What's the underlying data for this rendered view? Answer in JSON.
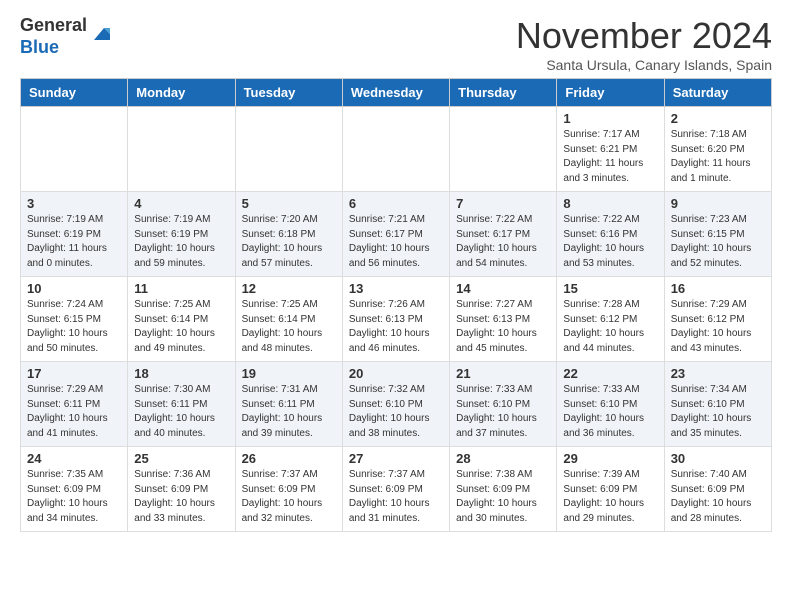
{
  "header": {
    "logo_general": "General",
    "logo_blue": "Blue",
    "month_title": "November 2024",
    "location": "Santa Ursula, Canary Islands, Spain"
  },
  "days_of_week": [
    "Sunday",
    "Monday",
    "Tuesday",
    "Wednesday",
    "Thursday",
    "Friday",
    "Saturday"
  ],
  "weeks": [
    [
      {
        "day": "",
        "info": ""
      },
      {
        "day": "",
        "info": ""
      },
      {
        "day": "",
        "info": ""
      },
      {
        "day": "",
        "info": ""
      },
      {
        "day": "",
        "info": ""
      },
      {
        "day": "1",
        "info": "Sunrise: 7:17 AM\nSunset: 6:21 PM\nDaylight: 11 hours and 3 minutes."
      },
      {
        "day": "2",
        "info": "Sunrise: 7:18 AM\nSunset: 6:20 PM\nDaylight: 11 hours and 1 minute."
      }
    ],
    [
      {
        "day": "3",
        "info": "Sunrise: 7:19 AM\nSunset: 6:19 PM\nDaylight: 11 hours and 0 minutes."
      },
      {
        "day": "4",
        "info": "Sunrise: 7:19 AM\nSunset: 6:19 PM\nDaylight: 10 hours and 59 minutes."
      },
      {
        "day": "5",
        "info": "Sunrise: 7:20 AM\nSunset: 6:18 PM\nDaylight: 10 hours and 57 minutes."
      },
      {
        "day": "6",
        "info": "Sunrise: 7:21 AM\nSunset: 6:17 PM\nDaylight: 10 hours and 56 minutes."
      },
      {
        "day": "7",
        "info": "Sunrise: 7:22 AM\nSunset: 6:17 PM\nDaylight: 10 hours and 54 minutes."
      },
      {
        "day": "8",
        "info": "Sunrise: 7:22 AM\nSunset: 6:16 PM\nDaylight: 10 hours and 53 minutes."
      },
      {
        "day": "9",
        "info": "Sunrise: 7:23 AM\nSunset: 6:15 PM\nDaylight: 10 hours and 52 minutes."
      }
    ],
    [
      {
        "day": "10",
        "info": "Sunrise: 7:24 AM\nSunset: 6:15 PM\nDaylight: 10 hours and 50 minutes."
      },
      {
        "day": "11",
        "info": "Sunrise: 7:25 AM\nSunset: 6:14 PM\nDaylight: 10 hours and 49 minutes."
      },
      {
        "day": "12",
        "info": "Sunrise: 7:25 AM\nSunset: 6:14 PM\nDaylight: 10 hours and 48 minutes."
      },
      {
        "day": "13",
        "info": "Sunrise: 7:26 AM\nSunset: 6:13 PM\nDaylight: 10 hours and 46 minutes."
      },
      {
        "day": "14",
        "info": "Sunrise: 7:27 AM\nSunset: 6:13 PM\nDaylight: 10 hours and 45 minutes."
      },
      {
        "day": "15",
        "info": "Sunrise: 7:28 AM\nSunset: 6:12 PM\nDaylight: 10 hours and 44 minutes."
      },
      {
        "day": "16",
        "info": "Sunrise: 7:29 AM\nSunset: 6:12 PM\nDaylight: 10 hours and 43 minutes."
      }
    ],
    [
      {
        "day": "17",
        "info": "Sunrise: 7:29 AM\nSunset: 6:11 PM\nDaylight: 10 hours and 41 minutes."
      },
      {
        "day": "18",
        "info": "Sunrise: 7:30 AM\nSunset: 6:11 PM\nDaylight: 10 hours and 40 minutes."
      },
      {
        "day": "19",
        "info": "Sunrise: 7:31 AM\nSunset: 6:11 PM\nDaylight: 10 hours and 39 minutes."
      },
      {
        "day": "20",
        "info": "Sunrise: 7:32 AM\nSunset: 6:10 PM\nDaylight: 10 hours and 38 minutes."
      },
      {
        "day": "21",
        "info": "Sunrise: 7:33 AM\nSunset: 6:10 PM\nDaylight: 10 hours and 37 minutes."
      },
      {
        "day": "22",
        "info": "Sunrise: 7:33 AM\nSunset: 6:10 PM\nDaylight: 10 hours and 36 minutes."
      },
      {
        "day": "23",
        "info": "Sunrise: 7:34 AM\nSunset: 6:10 PM\nDaylight: 10 hours and 35 minutes."
      }
    ],
    [
      {
        "day": "24",
        "info": "Sunrise: 7:35 AM\nSunset: 6:09 PM\nDaylight: 10 hours and 34 minutes."
      },
      {
        "day": "25",
        "info": "Sunrise: 7:36 AM\nSunset: 6:09 PM\nDaylight: 10 hours and 33 minutes."
      },
      {
        "day": "26",
        "info": "Sunrise: 7:37 AM\nSunset: 6:09 PM\nDaylight: 10 hours and 32 minutes."
      },
      {
        "day": "27",
        "info": "Sunrise: 7:37 AM\nSunset: 6:09 PM\nDaylight: 10 hours and 31 minutes."
      },
      {
        "day": "28",
        "info": "Sunrise: 7:38 AM\nSunset: 6:09 PM\nDaylight: 10 hours and 30 minutes."
      },
      {
        "day": "29",
        "info": "Sunrise: 7:39 AM\nSunset: 6:09 PM\nDaylight: 10 hours and 29 minutes."
      },
      {
        "day": "30",
        "info": "Sunrise: 7:40 AM\nSunset: 6:09 PM\nDaylight: 10 hours and 28 minutes."
      }
    ]
  ]
}
